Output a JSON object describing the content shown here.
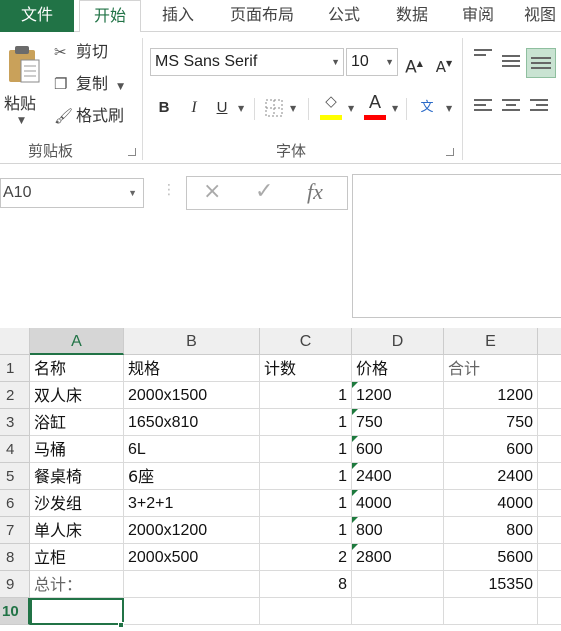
{
  "tabs": [
    "文件",
    "开始",
    "插入",
    "页面布局",
    "公式",
    "数据",
    "审阅",
    "视图"
  ],
  "clipboard": {
    "paste_label": "粘贴",
    "cut_label": "剪切",
    "copy_label": "复制",
    "format_painter_label": "格式刷",
    "group_label": "剪贴板"
  },
  "font": {
    "font_name": "MS Sans Serif",
    "font_size": "10",
    "group_label": "字体",
    "grow_label": "A",
    "shrink_label": "A",
    "bold_label": "B",
    "italic_label": "I",
    "underline_label": "U",
    "font_color_label": "A",
    "phonetic_label": "文",
    "highlight_color": "#ffff00",
    "font_color": "#ff0000"
  },
  "formula_bar": {
    "name_box": "A10",
    "cancel_icon": "×",
    "enter_icon": "✓",
    "fx_label": "fx",
    "formula": ""
  },
  "sheet": {
    "columns": [
      "A",
      "B",
      "C",
      "D",
      "E"
    ],
    "selected_column": "A",
    "rows": [
      "1",
      "2",
      "3",
      "4",
      "5",
      "6",
      "7",
      "8",
      "9",
      "10"
    ],
    "selected_row": "10",
    "cells": [
      [
        "名称",
        "规格",
        "计数",
        "价格",
        "合计"
      ],
      [
        "双人床",
        "2000x1500",
        "1",
        "1200",
        "1200"
      ],
      [
        "浴缸",
        "1650x810",
        "1",
        "750",
        "750"
      ],
      [
        "马桶",
        "6L",
        "1",
        "600",
        "600"
      ],
      [
        "餐桌椅",
        "6座",
        "1",
        "2400",
        "2400"
      ],
      [
        "沙发组",
        "3+2+1",
        "1",
        "4000",
        "4000"
      ],
      [
        "单人床",
        "2000x1200",
        "1",
        "800",
        "800"
      ],
      [
        "立柜",
        "2000x500",
        "2",
        "2800",
        "5600"
      ],
      [
        "总计：",
        "",
        "8",
        "",
        "15350"
      ],
      [
        "",
        "",
        "",
        "",
        ""
      ]
    ]
  },
  "colors": {
    "accent": "#217346",
    "error_triangle": "#1e7a3e"
  }
}
